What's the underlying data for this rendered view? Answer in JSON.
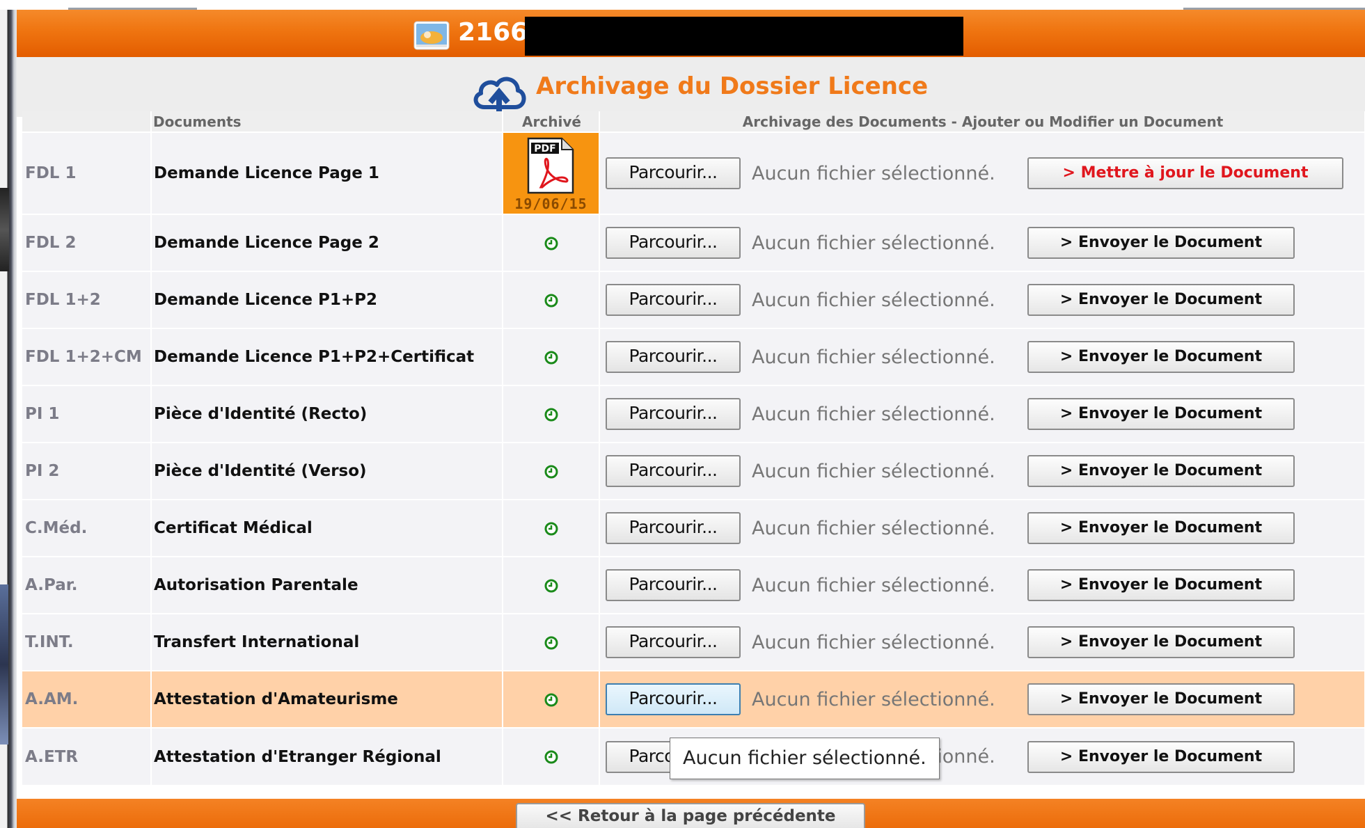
{
  "header": {
    "id_text": "2166",
    "id_icon": "id-card-icon",
    "title": "Archivage du Dossier Licence",
    "title_icon": "cloud-upload-icon"
  },
  "table": {
    "columns": {
      "code": "",
      "documents": "Documents",
      "archive": "Archivé",
      "action": "Archivage des Documents - Ajouter ou Modifier un Document"
    },
    "browse_label": "Parcourir...",
    "no_file_label": "Aucun fichier sélectionné.",
    "rows": [
      {
        "code": "FDL 1",
        "name": "Demande Licence Page 1",
        "archived": "19/06/15",
        "button": "> Mettre à jour le Document"
      },
      {
        "code": "FDL 2",
        "name": "Demande Licence Page 2",
        "button": "> Envoyer le Document"
      },
      {
        "code": "FDL 1+2",
        "name": "Demande Licence P1+P2",
        "button": "> Envoyer le Document"
      },
      {
        "code": "FDL 1+2+CM",
        "name": "Demande Licence P1+P2+Certificat",
        "button": "> Envoyer le Document"
      },
      {
        "code": "PI 1",
        "name": "Pièce d'Identité (Recto)",
        "button": "> Envoyer le Document"
      },
      {
        "code": "PI 2",
        "name": "Pièce d'Identité (Verso)",
        "button": "> Envoyer le Document"
      },
      {
        "code": "C.Méd.",
        "name": "Certificat Médical",
        "button": "> Envoyer le Document"
      },
      {
        "code": "A.Par.",
        "name": "Autorisation Parentale",
        "button": "> Envoyer le Document"
      },
      {
        "code": "T.INT.",
        "name": "Transfert International",
        "button": "> Envoyer le Document"
      },
      {
        "code": "A.AM.",
        "name": "Attestation d'Amateurisme",
        "button": "> Envoyer le Document"
      },
      {
        "code": "A.ETR",
        "name": "Attestation d'Etranger Régional",
        "button": "> Envoyer le Document"
      }
    ]
  },
  "tooltip": "Aucun fichier sélectionné.",
  "footer": {
    "back_label": "<< Retour à la page précédente"
  },
  "colors": {
    "accent_orange": "#ef7410",
    "title_orange": "#f07a1a",
    "highlight_row": "#ffd1a8",
    "update_red": "#e0161d",
    "clock_green": "#1a8a1a",
    "cloud_blue": "#1f4e9c"
  }
}
